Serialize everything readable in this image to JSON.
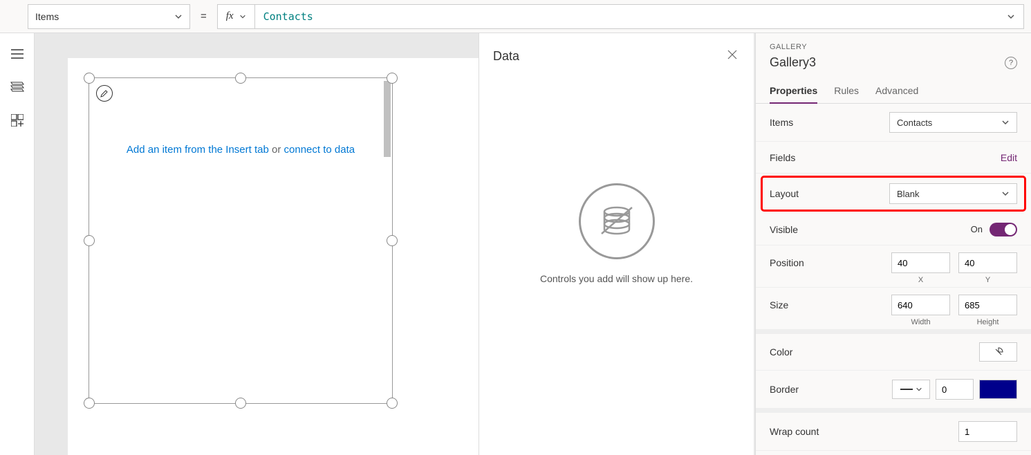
{
  "formula_bar": {
    "property": "Items",
    "equals": "=",
    "fx": "fx",
    "value": "Contacts"
  },
  "canvas": {
    "insert_link": "Add an item from the Insert tab",
    "or_text": " or ",
    "connect_link": "connect to data"
  },
  "data_pane": {
    "title": "Data",
    "empty_message": "Controls you add will show up here."
  },
  "props": {
    "control_type": "GALLERY",
    "control_name": "Gallery3",
    "tabs": {
      "properties": "Properties",
      "rules": "Rules",
      "advanced": "Advanced"
    },
    "items": {
      "label": "Items",
      "value": "Contacts"
    },
    "fields": {
      "label": "Fields",
      "action": "Edit"
    },
    "layout": {
      "label": "Layout",
      "value": "Blank"
    },
    "visible": {
      "label": "Visible",
      "value": "On"
    },
    "position": {
      "label": "Position",
      "x": "40",
      "y": "40",
      "x_label": "X",
      "y_label": "Y"
    },
    "size": {
      "label": "Size",
      "width": "640",
      "height": "685",
      "width_label": "Width",
      "height_label": "Height"
    },
    "color": {
      "label": "Color"
    },
    "border": {
      "label": "Border",
      "width_value": "0"
    },
    "wrap_count": {
      "label": "Wrap count",
      "value": "1"
    }
  }
}
